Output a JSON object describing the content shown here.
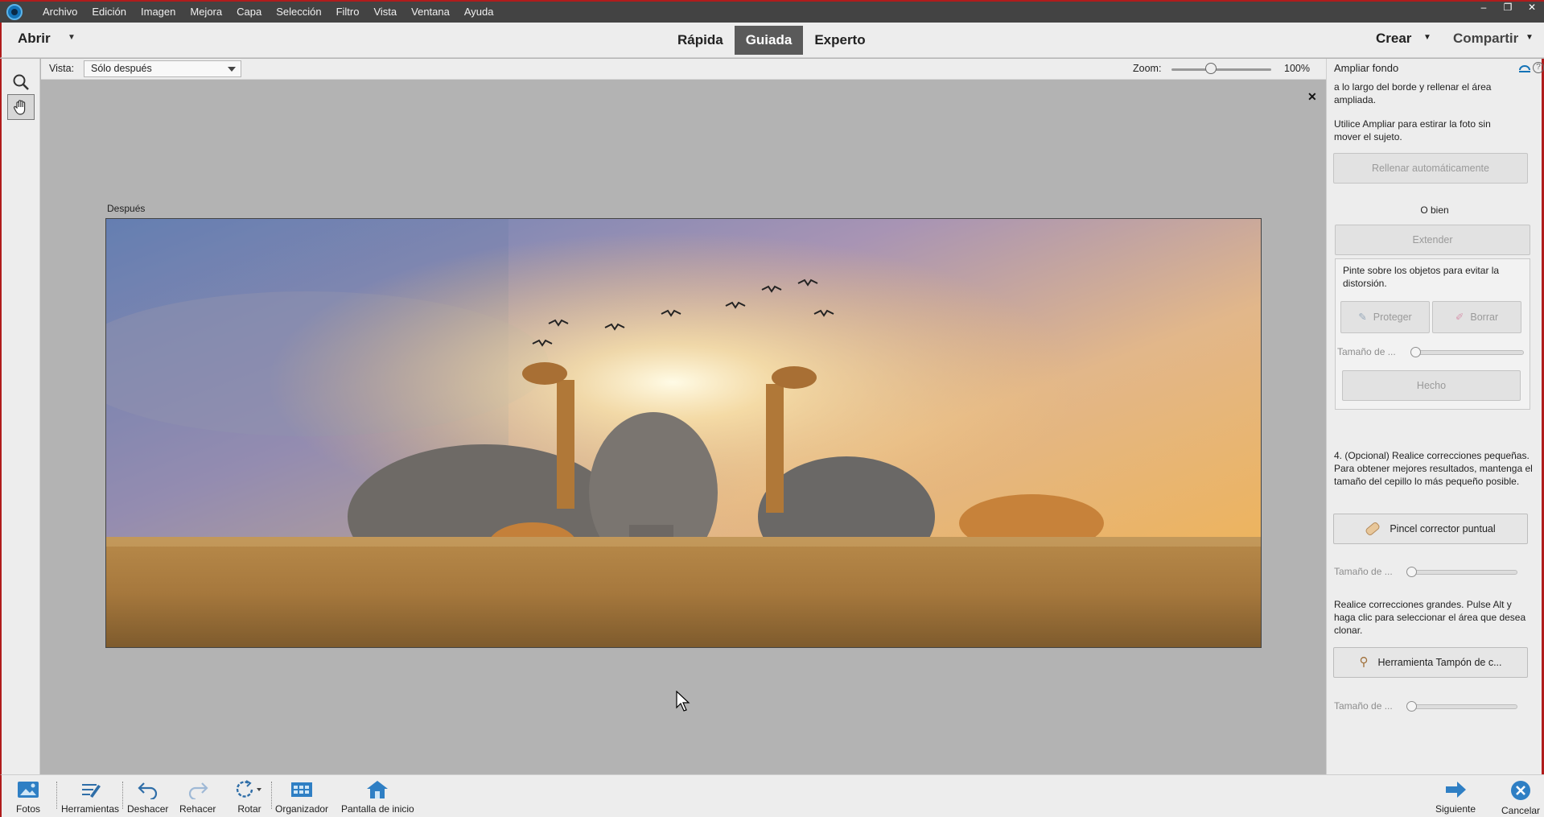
{
  "menubar": {
    "items": [
      "Archivo",
      "Edición",
      "Imagen",
      "Mejora",
      "Capa",
      "Selección",
      "Filtro",
      "Vista",
      "Ventana",
      "Ayuda"
    ],
    "window_controls": [
      "–",
      "❐",
      "✕"
    ]
  },
  "modebar": {
    "open_label": "Abrir",
    "tabs": [
      {
        "label": "Rápida",
        "active": false
      },
      {
        "label": "Guiada",
        "active": true
      },
      {
        "label": "Experto",
        "active": false
      }
    ],
    "create_label": "Crear",
    "share_label": "Compartir"
  },
  "options": {
    "view_label": "Vista:",
    "view_value": "Sólo después",
    "zoom_label": "Zoom:",
    "zoom_value": "100%"
  },
  "canvas": {
    "after_label": "Después",
    "close_glyph": "✕"
  },
  "panel": {
    "title": "Ampliar fondo",
    "intro_text": "a lo largo del borde y rellenar el área ampliada.",
    "stretch_text": "Utilice Ampliar para estirar la foto sin mover el sujeto.",
    "autofill_label": "Rellenar automáticamente",
    "or_label": "O bien",
    "extend_label": "Extender",
    "protect_hint": "Pinte sobre los objetos para evitar la distorsión.",
    "protect_label": "Proteger",
    "erase_label": "Borrar",
    "size_label": "Tamaño de ...",
    "done_label": "Hecho",
    "step4_text": "4. (Opcional) Realice correcciones pequeñas. Para obtener mejores resultados, mantenga el tamaño del cepillo lo más pequeño posible.",
    "spot_heal_label": "Pincel corrector puntual",
    "clone_text": "Realice correcciones grandes. Pulse Alt y haga clic para seleccionar el área que desea clonar.",
    "clone_label": "Herramienta Tampón de c...",
    "colors": {
      "accent": "#1473b7",
      "frame": "#b01c1c"
    }
  },
  "bottombar": {
    "photos": "Fotos",
    "tools": "Herramientas",
    "undo": "Deshacer",
    "redo": "Rehacer",
    "rotate": "Rotar",
    "organizer": "Organizador",
    "home": "Pantalla de inicio",
    "next": "Siguiente",
    "cancel": "Cancelar"
  }
}
